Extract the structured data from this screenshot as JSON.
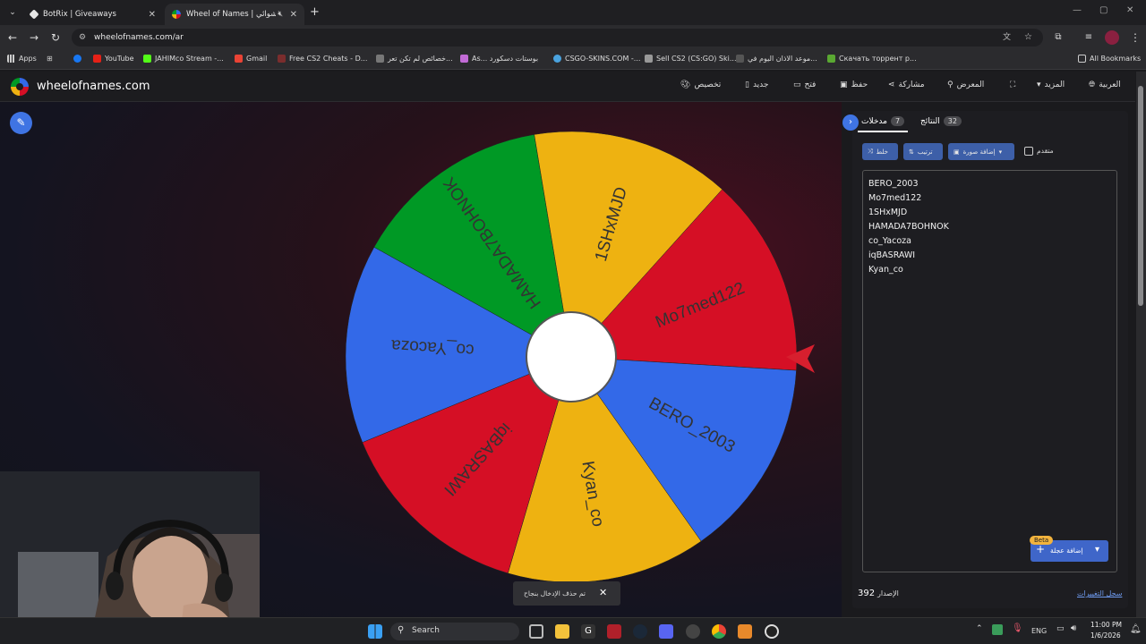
{
  "browser": {
    "tabs": [
      {
        "title": "BotRix | Giveaways",
        "active": false
      },
      {
        "title": "Wheel of Names | العشوائي",
        "active": true
      }
    ],
    "url": "wheelofnames.com/ar",
    "bookmarks": [
      {
        "label": "Apps"
      },
      {
        "label": "YouTube"
      },
      {
        "label": "JAHIMco Stream -..."
      },
      {
        "label": "Gmail"
      },
      {
        "label": "Free CS2 Cheats - D..."
      },
      {
        "label": "خصائص لم تكن تعر..."
      },
      {
        "label": "As... بوستات دسكورد"
      },
      {
        "label": "CSGO-SKINS.COM -..."
      },
      {
        "label": "Sell CS2 (CS:GO) Ski..."
      },
      {
        "label": "موعد الاذان اليوم في..."
      },
      {
        "label": "Скачать торрент р..."
      },
      {
        "label": "All Bookmarks"
      }
    ]
  },
  "site": {
    "name": "wheelofnames.com",
    "menu": {
      "customize": "تخصيص",
      "new": "جديد",
      "open": "فتح",
      "save": "حفظ",
      "share": "مشاركة",
      "gallery": "المعرض",
      "more": "المزيد",
      "language": "العربية"
    }
  },
  "wheel": {
    "segments": [
      {
        "label": "Mo7med122",
        "color": "#d50f25"
      },
      {
        "label": "BERO_2003",
        "color": "#3369e8"
      },
      {
        "label": "Kyan_co",
        "color": "#eeb211"
      },
      {
        "label": "iqBASRAWI",
        "color": "#d50f25"
      },
      {
        "label": "co_Yacoza",
        "color": "#3369e8"
      },
      {
        "label": "HAMADA7BOHNOK",
        "color": "#009925"
      },
      {
        "label": "1SHxMJD",
        "color": "#eeb211"
      }
    ]
  },
  "panel": {
    "tab_entries": {
      "label": "مدخلات",
      "count": "7"
    },
    "tab_results": {
      "label": "النتائج",
      "count": "32"
    },
    "shuffle_label": "خلط",
    "sort_label": "ترتيب",
    "add_image_label": "إضافة صورة",
    "advanced_label": "متقدم",
    "entries": [
      "BERO_2003",
      "Mo7med122",
      "1SHxMJD",
      "HAMADA7BOHNOK",
      "co_Yacoza",
      "iqBASRAWI",
      "Kyan_co"
    ],
    "add_wheel_label": "إضافة عجلة",
    "beta_label": "Beta",
    "version_label": "الإصدار",
    "version_number": "392",
    "changelog_label": "سجل التغييرات"
  },
  "toast": {
    "text": "تم حذف الإدخال بنجاح"
  },
  "taskbar": {
    "search_label": "Search",
    "lang": "ENG",
    "time": "11:00 PM",
    "date": "1/6/2026"
  }
}
